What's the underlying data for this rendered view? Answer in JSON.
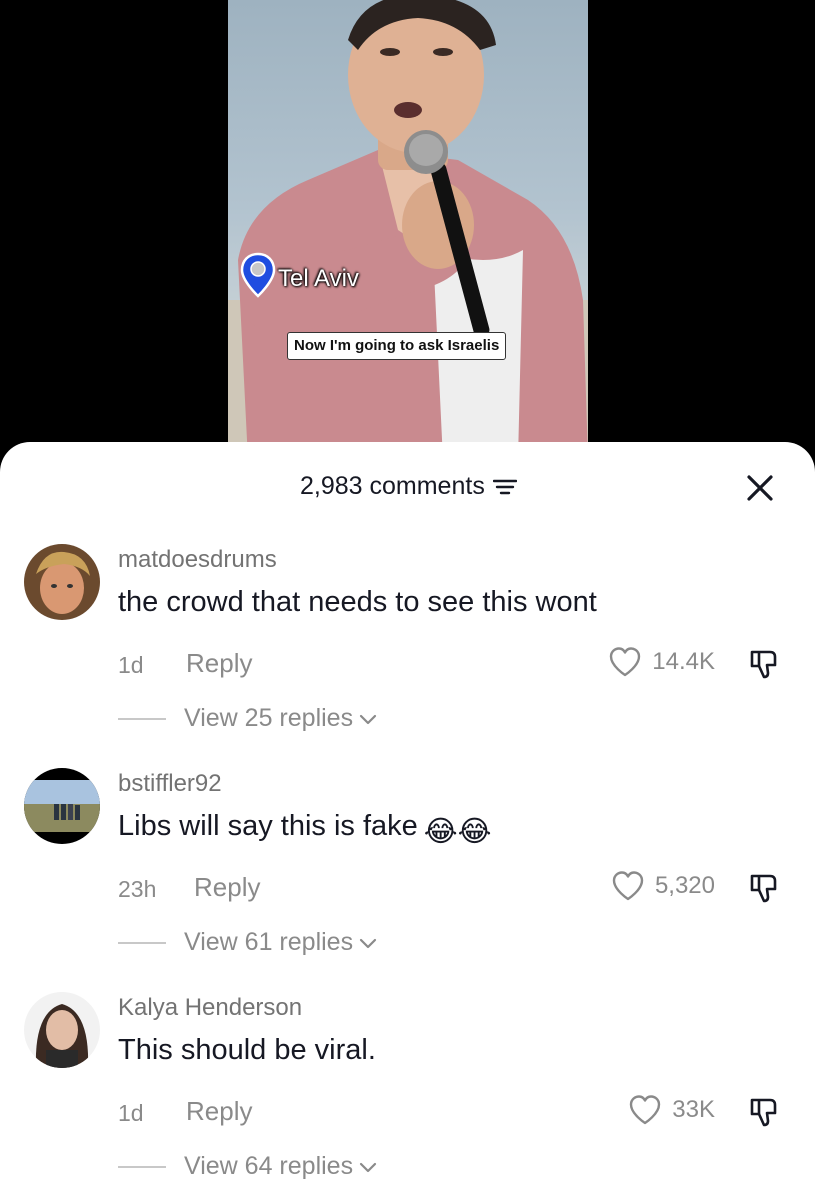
{
  "video": {
    "location": "Tel Aviv",
    "caption": "Now I'm going to ask Israelis"
  },
  "sheet": {
    "comment_count": "2,983 comments",
    "icons": {
      "sort": "sort-filter-icon",
      "close": "close-icon"
    }
  },
  "comments": [
    {
      "username": "matdoesdrums",
      "text": "the crowd that needs to see this wont",
      "time": "1d",
      "reply_label": "Reply",
      "likes": "14.4K",
      "view_replies": "View 25 replies"
    },
    {
      "username": "bstiffler92",
      "text": "Libs will say this is fake",
      "emoji": "😂😂",
      "time": "23h",
      "reply_label": "Reply",
      "likes": "5,320",
      "view_replies": "View 61 replies"
    },
    {
      "username": "Kalya Henderson",
      "text": "This should be viral.",
      "time": "1d",
      "reply_label": "Reply",
      "likes": "33K",
      "view_replies": "View 64 replies"
    }
  ],
  "colors": {
    "text_primary": "#161823",
    "text_secondary": "#8a8a8a",
    "location_pin": "#1f4de0"
  }
}
